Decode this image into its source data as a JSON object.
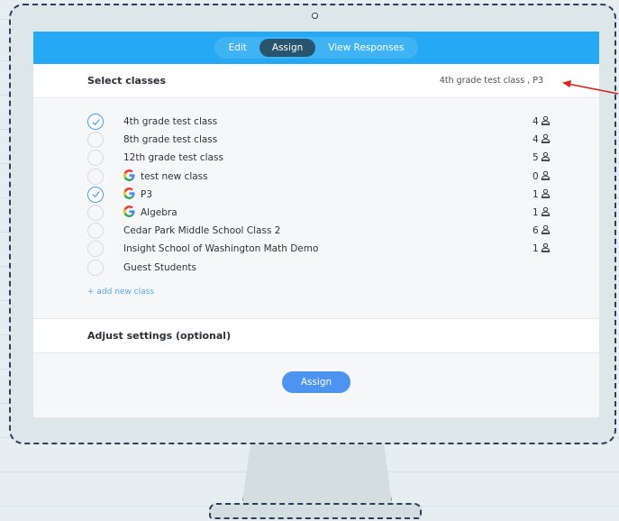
{
  "tabs": [
    {
      "label": "Edit",
      "active": false
    },
    {
      "label": "Assign",
      "active": true
    },
    {
      "label": "View Responses",
      "active": false
    }
  ],
  "select_section": {
    "title": "Select classes",
    "summary": "4th grade test class , P3"
  },
  "classes": [
    {
      "name": "4th grade test class",
      "count": "4",
      "checked": true,
      "google": false
    },
    {
      "name": "8th grade test class",
      "count": "4",
      "checked": false,
      "google": false
    },
    {
      "name": "12th grade test class",
      "count": "5",
      "checked": false,
      "google": false
    },
    {
      "name": "test new class",
      "count": "0",
      "checked": false,
      "google": true
    },
    {
      "name": "P3",
      "count": "1",
      "checked": true,
      "google": true
    },
    {
      "name": "Algebra",
      "count": "1",
      "checked": false,
      "google": true
    },
    {
      "name": "Cedar Park Middle School Class 2",
      "count": "6",
      "checked": false,
      "google": false
    },
    {
      "name": "Insight School of Washington Math Demo",
      "count": "1",
      "checked": false,
      "google": false
    },
    {
      "name": "Guest Students",
      "count": "",
      "checked": false,
      "google": false
    }
  ],
  "add_class_label": "+ add new class",
  "settings_title": "Adjust settings (optional)",
  "assign_label": "Assign",
  "colors": {
    "topbar": "#25a9f5",
    "active_tab": "#28546d",
    "check": "#4a9ee8",
    "assign_button": "#4c94ef",
    "annotation_arrow": "#e02020"
  }
}
